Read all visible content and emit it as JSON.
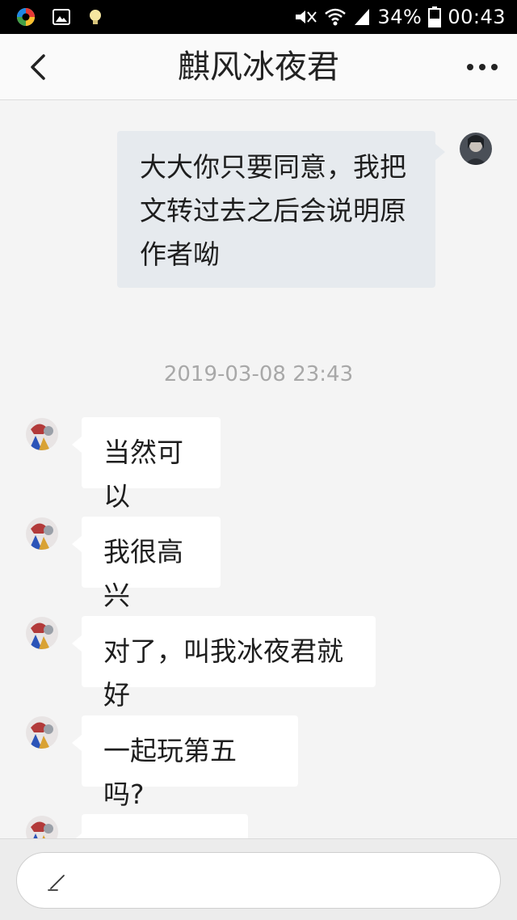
{
  "status_bar": {
    "battery": "34%",
    "time": "00:43",
    "icons": [
      "colorful-app-icon",
      "gallery-icon",
      "bulb-icon",
      "mute-icon",
      "wifi-icon",
      "signal-icon",
      "battery-icon"
    ]
  },
  "header": {
    "title": "麒风冰夜君",
    "back_icon": "chevron-left-icon",
    "more_icon": "more-dots-icon"
  },
  "messages": [
    {
      "side": "out",
      "lines": [
        "大大你只要同意，我把",
        "文转过去之后会说明原",
        "作者呦"
      ]
    },
    {
      "timestamp": "2019-03-08 23:43"
    },
    {
      "side": "in",
      "text": "当然可以"
    },
    {
      "side": "in",
      "text": "我很高兴"
    },
    {
      "side": "in",
      "text": "对了，叫我冰夜君就好"
    },
    {
      "side": "in",
      "text": "一起玩第五吗?"
    }
  ],
  "input": {
    "placeholder": "",
    "icon": "pencil-icon"
  },
  "colors": {
    "status_bar_bg": "#000000",
    "nav_bg": "#fafafa",
    "chat_bg": "#f4f4f4",
    "outgoing_bubble": "#e6eaee",
    "incoming_bubble": "#ffffff",
    "timestamp_text": "#a8a8a8"
  }
}
